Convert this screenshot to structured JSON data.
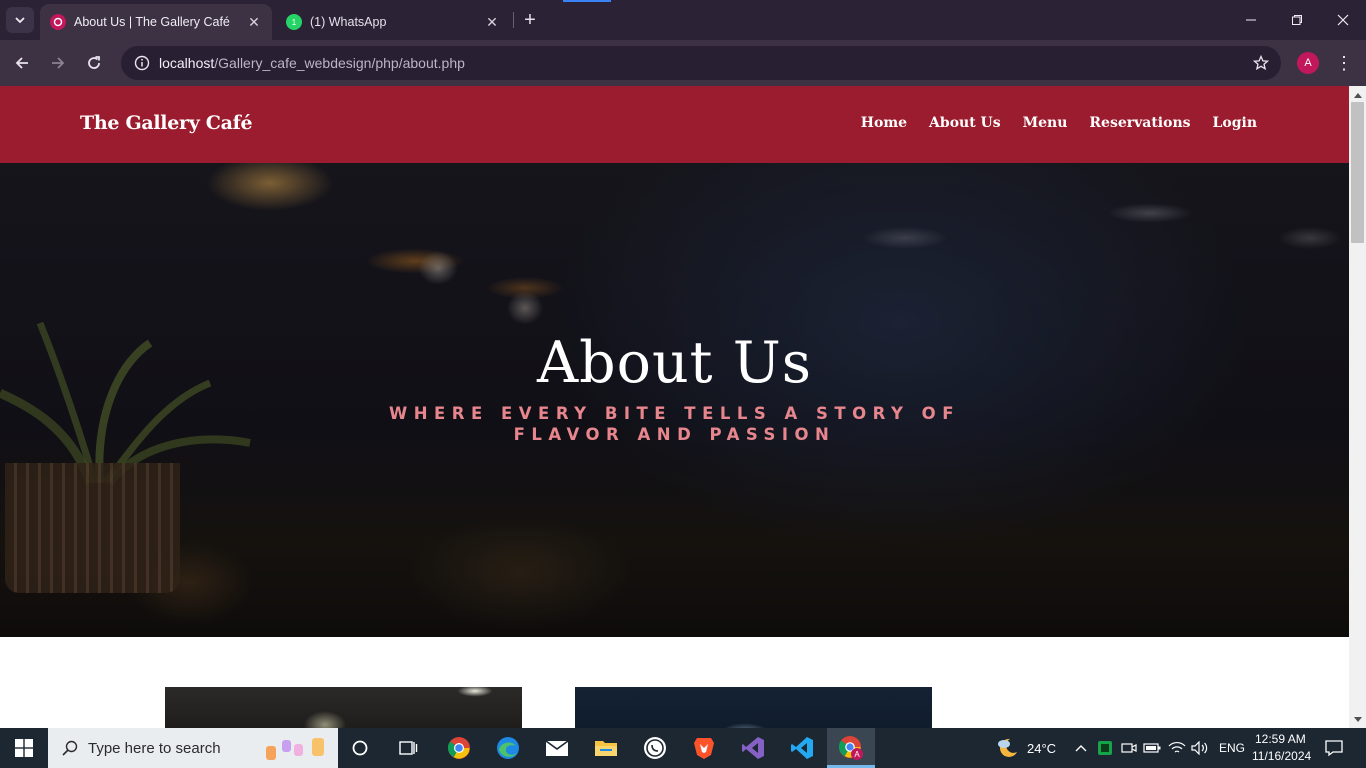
{
  "browser": {
    "tabs": [
      {
        "title": "About Us | The Gallery Café",
        "active": true,
        "favicon": "gallery-cafe-favicon"
      },
      {
        "title": "(1) WhatsApp",
        "active": false,
        "favicon": "whatsapp-icon"
      }
    ],
    "url": {
      "host": "localhost",
      "path": "/Gallery_cafe_webdesign/php/about.php"
    },
    "profile_initial": "A"
  },
  "site": {
    "brand": "The Gallery Café",
    "nav": [
      {
        "label": "Home"
      },
      {
        "label": "About Us"
      },
      {
        "label": "Menu"
      },
      {
        "label": "Reservations"
      },
      {
        "label": "Login"
      }
    ],
    "hero": {
      "title": "About Us",
      "subtitle": "WHERE EVERY BITE TELLS A STORY OF FLAVOR AND PASSION"
    },
    "colors": {
      "header_bg": "#9b1c2e",
      "subtitle": "#e8868e"
    }
  },
  "taskbar": {
    "search_placeholder": "Type here to search",
    "pinned": [
      "chrome-icon",
      "edge-icon",
      "mail-icon",
      "file-explorer-icon",
      "whatsapp-icon",
      "brave-icon",
      "visual-studio-icon",
      "vscode-icon",
      "chrome-profile-icon"
    ],
    "weather": "24°C",
    "language": "ENG",
    "time": "12:59 AM",
    "date": "11/16/2024"
  }
}
